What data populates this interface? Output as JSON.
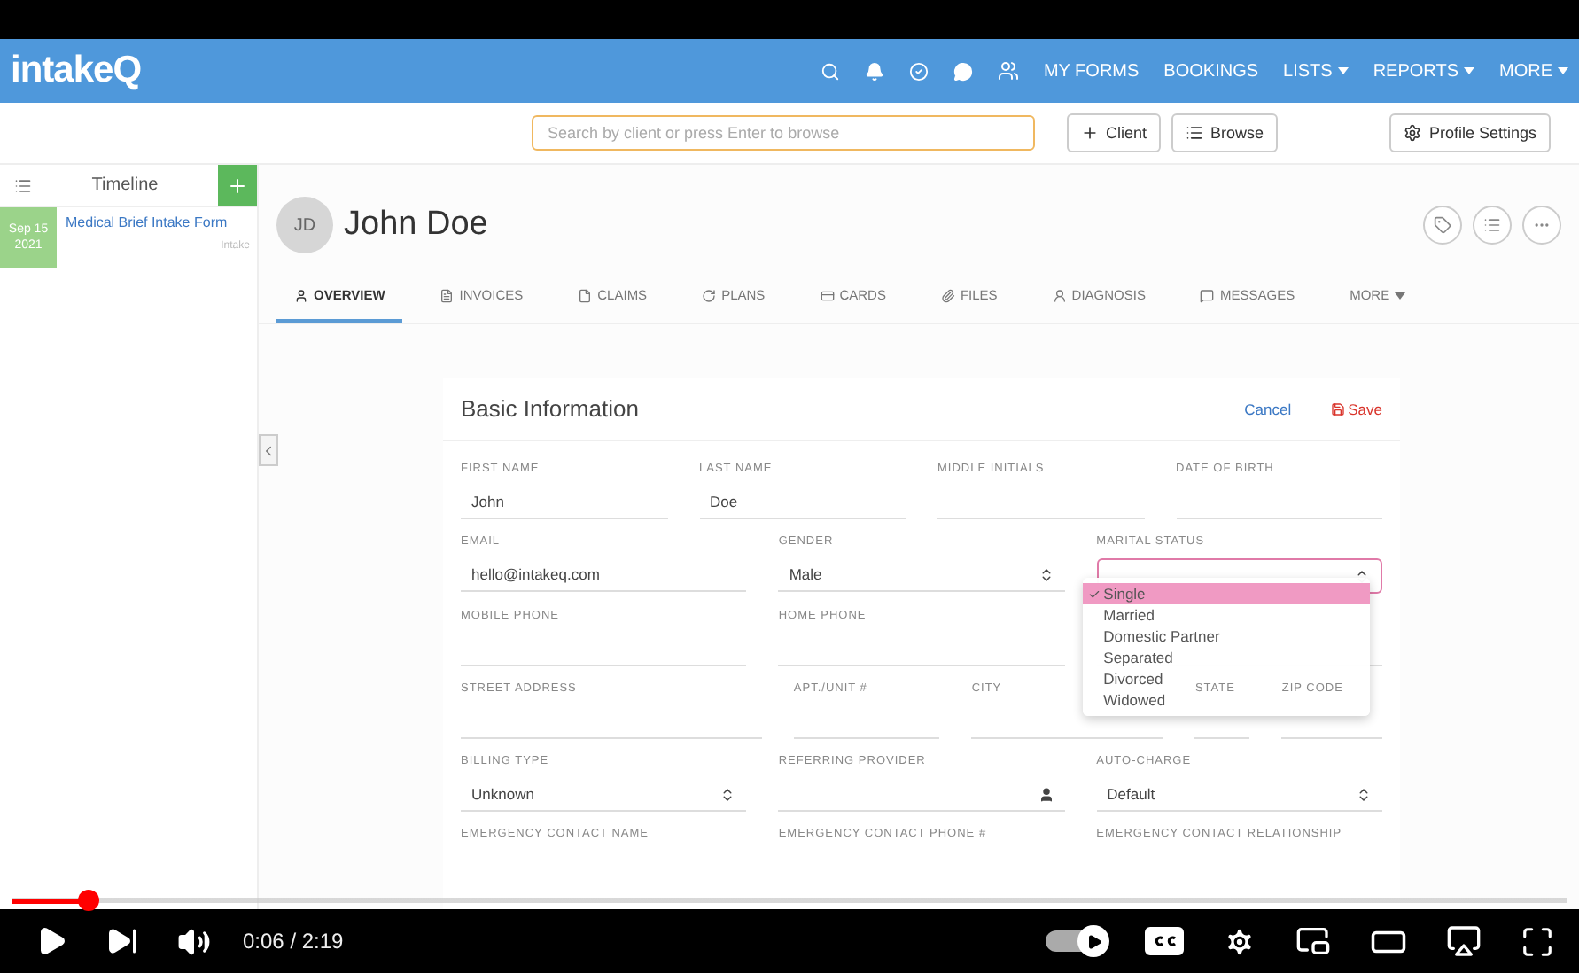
{
  "app": {
    "logo": "intakeQ",
    "nav_links": [
      {
        "label": "MY FORMS",
        "dropdown": false
      },
      {
        "label": "BOOKINGS",
        "dropdown": false
      },
      {
        "label": "LISTS",
        "dropdown": true
      },
      {
        "label": "REPORTS",
        "dropdown": true
      },
      {
        "label": "MORE",
        "dropdown": true
      }
    ],
    "search": {
      "placeholder": "Search by client or press Enter to browse"
    },
    "toolbar_buttons": [
      {
        "label": "Client",
        "kind": "add"
      },
      {
        "label": "Browse",
        "kind": "list"
      }
    ],
    "profile_button": "Profile Settings",
    "timeline": {
      "title": "Timeline",
      "entries": [
        {
          "day": "Sep 15",
          "year": "2021",
          "title": "Medical Brief Intake Form",
          "tag": "Intake"
        }
      ]
    },
    "client": {
      "initials": "JD",
      "name": "John Doe"
    },
    "tabs": [
      {
        "label": "OVERVIEW",
        "selected": true
      },
      {
        "label": "INVOICES",
        "selected": false
      },
      {
        "label": "CLAIMS",
        "selected": false
      },
      {
        "label": "PLANS",
        "selected": false
      },
      {
        "label": "CARDS",
        "selected": false
      },
      {
        "label": "FILES",
        "selected": false
      },
      {
        "label": "DIAGNOSIS",
        "selected": false
      },
      {
        "label": "MESSAGES",
        "selected": false
      },
      {
        "label": "MORE",
        "selected": false
      }
    ],
    "form": {
      "title": "Basic Information",
      "cancel": "Cancel",
      "save": "Save",
      "rows": [
        [
          {
            "label": "FIRST NAME",
            "value": "John",
            "kind": "text"
          },
          {
            "label": "LAST NAME",
            "value": "Doe",
            "kind": "text"
          },
          {
            "label": "MIDDLE INITIALS",
            "kind": "text"
          },
          {
            "label": "DATE OF BIRTH",
            "kind": "text"
          }
        ],
        [
          {
            "label": "EMAIL",
            "value": "hello@intakeq.com",
            "kind": "text"
          },
          {
            "label": "GENDER",
            "value": "Male",
            "kind": "select"
          },
          {
            "label": "MARITAL STATUS",
            "kind": "select",
            "open": true,
            "options": [
              {
                "label": "Single",
                "selected": true
              },
              {
                "label": "Married",
                "selected": false
              },
              {
                "label": "Domestic Partner",
                "selected": false
              },
              {
                "label": "Separated",
                "selected": false
              },
              {
                "label": "Divorced",
                "selected": false
              },
              {
                "label": "Widowed",
                "selected": false
              }
            ]
          }
        ],
        [
          {
            "label": "MOBILE PHONE",
            "kind": "text"
          },
          {
            "label": "HOME PHONE",
            "kind": "text"
          },
          {
            "kind": "text"
          }
        ],
        [
          {
            "label": "STREET ADDRESS",
            "kind": "text"
          },
          {
            "label": "APT./UNIT #",
            "kind": "text"
          },
          {
            "label": "CITY",
            "kind": "text"
          },
          {
            "label": "STATE",
            "kind": "text"
          },
          {
            "label": "ZIP CODE",
            "kind": "text"
          }
        ],
        [
          {
            "label": "BILLING TYPE",
            "value": "Unknown",
            "kind": "select"
          },
          {
            "label": "REFERRING PROVIDER",
            "kind": "lookup"
          },
          {
            "label": "AUTO-CHARGE",
            "value": "Default",
            "kind": "select"
          }
        ],
        [
          {
            "label": "EMERGENCY CONTACT NAME",
            "kind": "label"
          },
          {
            "label": "EMERGENCY CONTACT PHONE #",
            "kind": "label"
          },
          {
            "label": "EMERGENCY CONTACT RELATIONSHIP",
            "kind": "label"
          }
        ]
      ]
    }
  },
  "player": {
    "level": 0.049,
    "time": "0:06 / 2:19",
    "autoplay": {
      "on": true
    }
  }
}
